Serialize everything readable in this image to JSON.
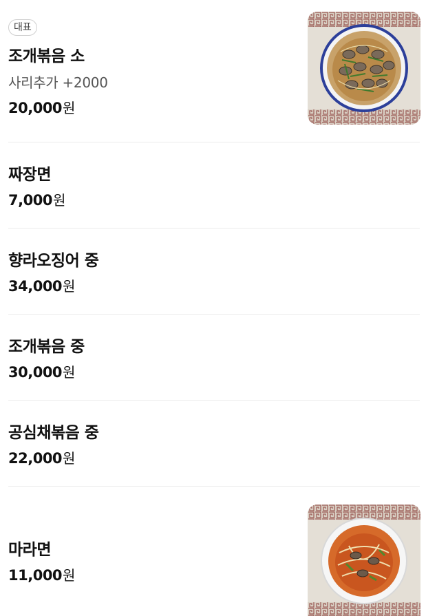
{
  "menu": {
    "items": [
      {
        "badge": "대표",
        "name": "조개볶음 소",
        "description": "사리추가 +2000",
        "price": "20,000",
        "currency": "원",
        "photo": "clam-noodle-photo"
      },
      {
        "name": "짜장면",
        "price": "7,000",
        "currency": "원"
      },
      {
        "name": "향라오징어 중",
        "price": "34,000",
        "currency": "원"
      },
      {
        "name": "조개볶음 중",
        "price": "30,000",
        "currency": "원"
      },
      {
        "name": "공심채볶음 중",
        "price": "22,000",
        "currency": "원"
      },
      {
        "name": "마라면",
        "price": "11,000",
        "currency": "원",
        "photo": "mala-noodle-photo"
      }
    ]
  },
  "colors": {
    "divider": "#ececec",
    "text": "#111111",
    "subtext": "#555555",
    "badge_border": "#cfcfcf"
  }
}
